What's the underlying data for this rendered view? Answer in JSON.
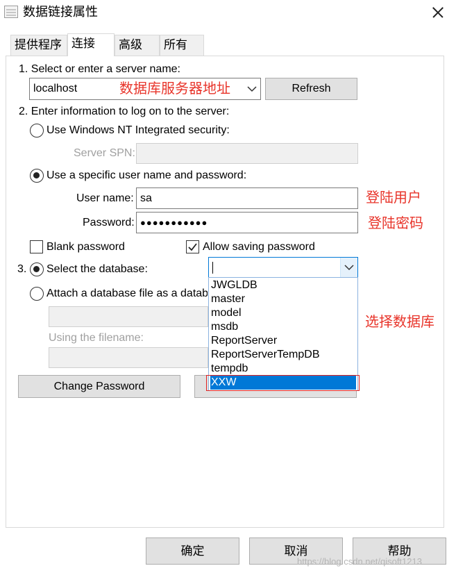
{
  "window": {
    "title": "数据链接属性",
    "close_label": "×"
  },
  "tabs": [
    {
      "label": "提供程序",
      "active": false
    },
    {
      "label": "连接",
      "active": true
    },
    {
      "label": "高级",
      "active": false
    },
    {
      "label": "所有",
      "active": false
    }
  ],
  "step1": {
    "label": "1. Select or enter a server name:",
    "server_value": "localhost",
    "refresh_label": "Refresh"
  },
  "step2": {
    "label": "2. Enter information to log on to the server:",
    "nt_security_label": "Use Windows NT Integrated security:",
    "server_spn_label": "Server SPN:",
    "specific_user_label": "Use a specific user name and password:",
    "username_label": "User name:",
    "username_value": "sa",
    "password_label": "Password:",
    "password_value": "●●●●●●●●●●●",
    "blank_password_label": "Blank password",
    "blank_password_checked": false,
    "allow_saving_label": "Allow saving password",
    "allow_saving_checked": true
  },
  "step3": {
    "number": "3.",
    "select_db_label": "Select the database:",
    "attach_label": "Attach a database file as a datab",
    "filename_label": "Using the filename:",
    "database_options": [
      "JWGLDB",
      "master",
      "model",
      "msdb",
      "ReportServer",
      "ReportServerTempDB",
      "tempdb",
      "XXW"
    ],
    "selected_option": "XXW"
  },
  "buttons": {
    "change_password": "Change Password",
    "ok": "确定",
    "cancel": "取消",
    "help": "帮助"
  },
  "annotations": {
    "server_note": "数据库服务器地址",
    "user_note": "登陆用户",
    "password_note": "登陆密码",
    "database_note": "选择数据库"
  },
  "watermark": "https://blog.csdn.net/qisoft1213",
  "colors": {
    "selection": "#0078d7",
    "annotation_red": "#e8342a",
    "button_face": "#e1e1e1"
  }
}
